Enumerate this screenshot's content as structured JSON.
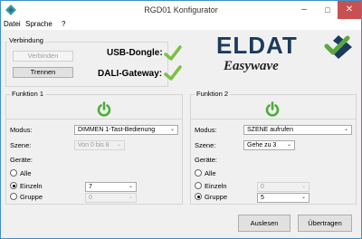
{
  "window": {
    "title": "RGD01 Konfigurator",
    "minimize_glyph": "–",
    "maximize_glyph": "□",
    "close_glyph": "✕"
  },
  "menu": {
    "items": [
      "Datei",
      "Sprache",
      "?"
    ]
  },
  "connection": {
    "group_title": "Verbindung",
    "connect_label": "Verbinden",
    "disconnect_label": "Trennen",
    "usb_label": "USB-Dongle:",
    "dali_label": "DALI-Gateway:"
  },
  "logo": {
    "brand": "ELDAT",
    "product": "Easywave"
  },
  "function1": {
    "group_title": "Funktion 1",
    "mode_label": "Modus:",
    "mode_value": "DIMMEN 1-Tast-Bedienung",
    "scene_label": "Szene:",
    "scene_value": "Von 0 bis 8",
    "devices_label": "Geräte:",
    "all_label": "Alle",
    "single_label": "Einzeln",
    "group_label": "Gruppe",
    "single_value": "7",
    "group_value": "0",
    "selected": "Einzeln"
  },
  "function2": {
    "group_title": "Funktion 2",
    "mode_label": "Modus:",
    "mode_value": "SZENE aufrufen",
    "scene_label": "Szene:",
    "scene_value": "Gehe zu 3",
    "devices_label": "Geräte:",
    "all_label": "Alle",
    "single_label": "Einzeln",
    "group_label": "Gruppe",
    "single_value": "0",
    "group_value": "5",
    "selected": "Gruppe"
  },
  "actions": {
    "read_label": "Auslesen",
    "transfer_label": "Übertragen"
  },
  "colors": {
    "power_green": "#4cae3a",
    "check_green": "#7bc043",
    "logo_green": "#5aa83c",
    "logo_blue": "#1a3a5e"
  }
}
